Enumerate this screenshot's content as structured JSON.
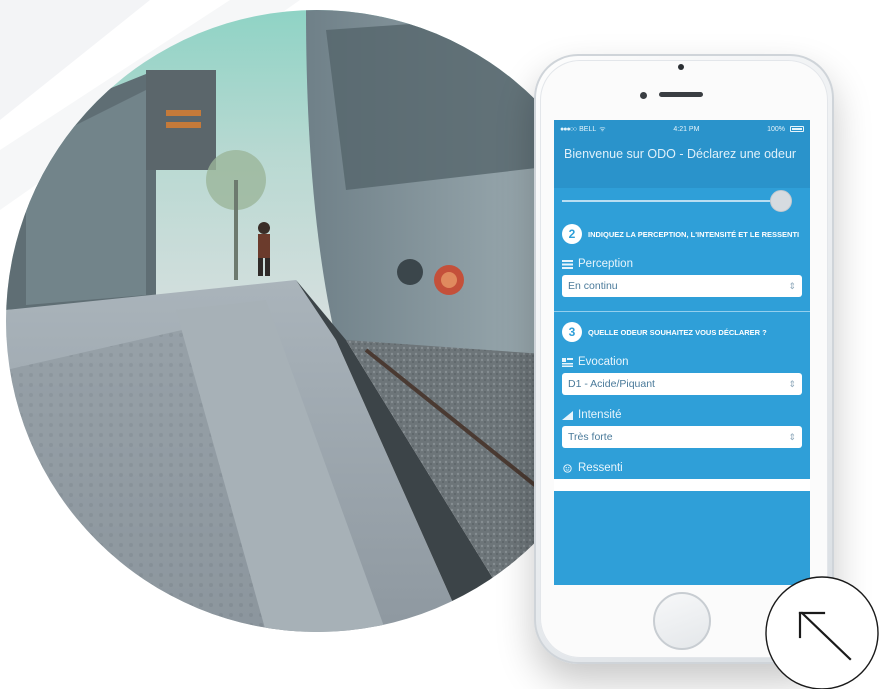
{
  "phone": {
    "status": {
      "carrier": "BELL",
      "time": "4:21 PM",
      "battery": "100%"
    },
    "header_title": "Bienvenue sur ODO - Déclarez une odeur",
    "steps": [
      {
        "number": "2",
        "text": "INDIQUEZ LA PERCEPTION, L'INTENSITÉ ET LE RESSENTI"
      },
      {
        "number": "3",
        "text": "QUELLE ODEUR SOUHAITEZ VOUS DÉCLARER ?"
      }
    ],
    "fields": {
      "perception": {
        "label": "Perception",
        "value": "En continu",
        "icon": "list-icon"
      },
      "evocation": {
        "label": "Evocation",
        "value": "D1 - Acide/Piquant",
        "icon": "evocation-icon"
      },
      "intensite": {
        "label": "Intensité",
        "value": "Très forte",
        "icon": "signal-bars-icon"
      },
      "ressenti": {
        "label": "Ressenti",
        "icon": "smiley-icon"
      }
    }
  },
  "colors": {
    "screen_blue": "#2f9fd8",
    "header_blue": "#2a93cb",
    "white": "#ffffff"
  },
  "icons": [
    "arrow-up-left-icon",
    "home-button",
    "camera",
    "speaker"
  ]
}
